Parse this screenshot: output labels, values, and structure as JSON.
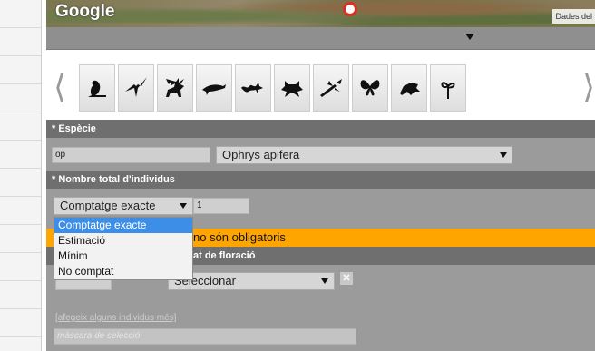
{
  "map": {
    "logo": "Google",
    "data_label": "Dades del"
  },
  "carousel": {
    "prev_symbol": "⟨",
    "next_symbol": "⟩",
    "icons": [
      "bird-icon",
      "bat-icon",
      "deer-icon",
      "dolphin-icon",
      "lizard-icon",
      "frog-icon",
      "dragonfly-icon",
      "butterfly-icon",
      "beetle-icon",
      "plant-icon"
    ]
  },
  "form": {
    "species_header": "* Espècie",
    "species_code": "op",
    "species_select": "Ophrys apifera",
    "count_header": "* Nombre total d'individus",
    "count_type_select": "Comptatge exacte",
    "count_value": "1",
    "dropdown_options": [
      "Comptatge exacte",
      "Estimació",
      "Mínim",
      "No comptat"
    ],
    "required_notice": "no són obligatoris",
    "flowering_header": "at de floració",
    "flowering_select": "Seleccionar",
    "close_symbol": "✕",
    "add_more_link": "[afegeix alguns individus més]",
    "mask_placeholder": "màscara de selecció"
  },
  "colors": {
    "accent_orange": "#ffa500",
    "header_gray": "#6f6f6f",
    "selected_blue": "#3d8ee6"
  }
}
